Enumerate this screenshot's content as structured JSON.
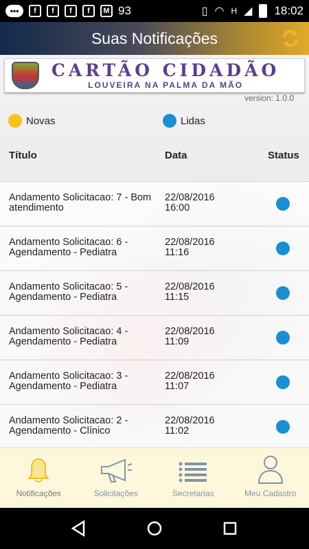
{
  "statusbar": {
    "notif_count": "93",
    "time": "18:02",
    "left_icons": [
      "message-icon",
      "facebook-icon",
      "facebook-icon",
      "facebook-icon",
      "facebook-icon",
      "mail-icon"
    ],
    "right_icons": [
      "vibrate-icon",
      "wifi-icon",
      "signal-icon",
      "battery-icon"
    ],
    "network": "H"
  },
  "header": {
    "title": "Suas Notificações",
    "refresh_icon": "refresh-icon",
    "accent": "#f2b52b"
  },
  "banner": {
    "brand_main": "CARTÃO CIDADÃO",
    "brand_sub": "LOUVEIRA NA PALMA DA MÃO",
    "version": "version: 1.0.0"
  },
  "legend": {
    "new_label": "Novas",
    "read_label": "Lidas",
    "new_color": "#f6c21a",
    "read_color": "#1a8fd2"
  },
  "table": {
    "headers": {
      "title": "Título",
      "date": "Data",
      "status": "Status"
    },
    "rows": [
      {
        "title": "Andamento Solicitacao: 7 - Bom atendimento",
        "date": "22/08/2016 16:00",
        "status": "read"
      },
      {
        "title": "Andamento Solicitacao: 6 - Agendamento - Pediatra",
        "date": "22/08/2016 11:16",
        "status": "read"
      },
      {
        "title": "Andamento Solicitacao: 5 - Agendamento - Pediatra",
        "date": "22/08/2016 11:15",
        "status": "read"
      },
      {
        "title": "Andamento Solicitacao: 4 - Agendamento - Pediatra",
        "date": "22/08/2016 11:09",
        "status": "read"
      },
      {
        "title": "Andamento Solicitacao: 3 - Agendamento - Pediatra",
        "date": "22/08/2016 11:07",
        "status": "read"
      },
      {
        "title": "Andamento Solicitacao: 2 - Agendamento - Clínico",
        "date": "22/08/2016 11:02",
        "status": "read"
      }
    ]
  },
  "tabs": [
    {
      "label": "Notificações",
      "icon": "bell-icon",
      "active": true
    },
    {
      "label": "Solicitações",
      "icon": "megaphone-icon",
      "active": false
    },
    {
      "label": "Secretarias",
      "icon": "list-icon",
      "active": false
    },
    {
      "label": "Meu Cadastro",
      "icon": "user-icon",
      "active": false
    }
  ],
  "navbar": [
    "back-icon",
    "home-icon",
    "recents-icon"
  ]
}
